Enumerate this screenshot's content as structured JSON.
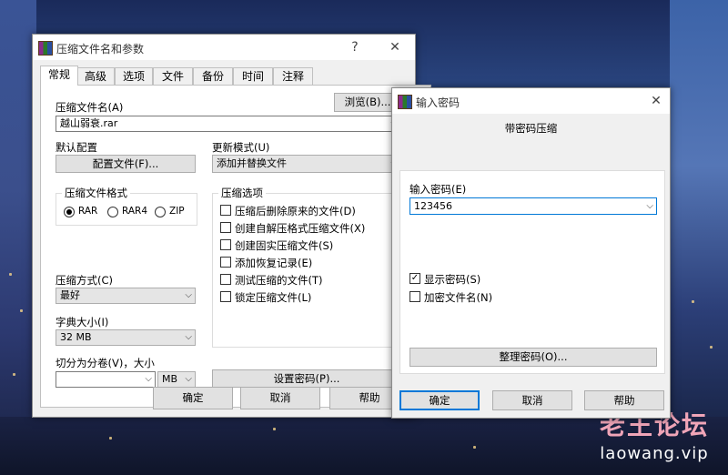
{
  "main_dialog": {
    "title": "压缩文件名和参数",
    "help_glyph": "?",
    "close_glyph": "✕",
    "tabs": [
      "常规",
      "高级",
      "选项",
      "文件",
      "备份",
      "时间",
      "注释"
    ],
    "archive_name_label": "压缩文件名(A)",
    "browse_label": "浏览(B)...",
    "archive_name_value": "越山弱衰.rar",
    "default_profile_label": "默认配置",
    "profiles_button": "配置文件(F)...",
    "update_mode_label": "更新模式(U)",
    "update_mode_value": "添加并替换文件",
    "format_group": "压缩文件格式",
    "formats": [
      "RAR",
      "RAR4",
      "ZIP"
    ],
    "selected_format": "RAR",
    "options_group": "压缩选项",
    "options": [
      {
        "label": "压缩后删除原来的文件(D)",
        "checked": false
      },
      {
        "label": "创建自解压格式压缩文件(X)",
        "checked": false
      },
      {
        "label": "创建固实压缩文件(S)",
        "checked": false
      },
      {
        "label": "添加恢复记录(E)",
        "checked": false
      },
      {
        "label": "测试压缩的文件(T)",
        "checked": false
      },
      {
        "label": "锁定压缩文件(L)",
        "checked": false
      }
    ],
    "method_label": "压缩方式(C)",
    "method_value": "最好",
    "dict_label": "字典大小(I)",
    "dict_value": "32 MB",
    "split_label": "切分为分卷(V)，大小",
    "split_value": "",
    "split_unit": "MB",
    "set_password_button": "设置密码(P)...",
    "ok": "确定",
    "cancel": "取消",
    "help": "帮助"
  },
  "password_dialog": {
    "title": "输入密码",
    "close_glyph": "✕",
    "heading": "带密码压缩",
    "enter_password_label": "输入密码(E)",
    "password_value": "123456",
    "show_password_label": "显示密码(S)",
    "show_password_checked": true,
    "encrypt_names_label": "加密文件名(N)",
    "encrypt_names_checked": false,
    "organize_button": "整理密码(O)...",
    "ok": "确定",
    "cancel": "取消",
    "help": "帮助"
  },
  "watermark": {
    "logo": "老王论坛",
    "url": "laowang.vip"
  }
}
